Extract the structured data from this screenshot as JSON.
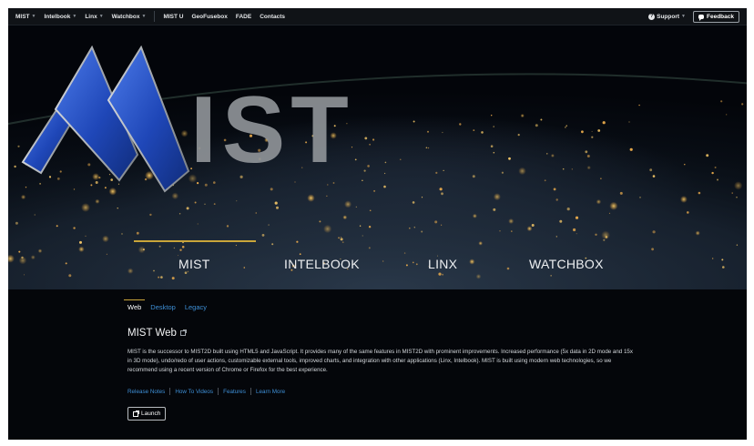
{
  "navbar": {
    "left_menus": [
      {
        "label": "MIST",
        "has_dropdown": true
      },
      {
        "label": "Intelbook",
        "has_dropdown": true
      },
      {
        "label": "Linx",
        "has_dropdown": true
      },
      {
        "label": "Watchbox",
        "has_dropdown": true
      }
    ],
    "links": [
      "MIST U",
      "GeoFusebox",
      "FADE",
      "Contacts"
    ],
    "support_label": "Support",
    "feedback_label": "Feedback"
  },
  "hero": {
    "logo_text": "IST",
    "tabs": [
      "MIST",
      "INTELBOOK",
      "LINX",
      "WATCHBOX"
    ],
    "active_tab": "MIST"
  },
  "content": {
    "subtabs": [
      "Web",
      "Desktop",
      "Legacy"
    ],
    "active_subtab": "Web",
    "title": "MIST Web",
    "description": "MIST is the successor to MIST2D built using HTML5 and JavaScript. It provides many of the same features in MIST2D with prominent improvements. Increased performance (5x data in 2D mode and 15x in 3D mode), undo/redo of user actions, customizable external tools, improved charts, and integration with other applications (Linx, Intelbook). MIST is built using modern web technologies, so we recommend using a recent version of Chrome or Firefox for the best experience.",
    "links": [
      "Release Notes",
      "How To Videos",
      "Features",
      "Learn More"
    ],
    "launch_label": "Launch"
  },
  "colors": {
    "accent_gold": "#c9a53a",
    "link_blue": "#3e8fd6",
    "logo_blue": "#2a55c8",
    "logo_gray": "#8e9297"
  }
}
